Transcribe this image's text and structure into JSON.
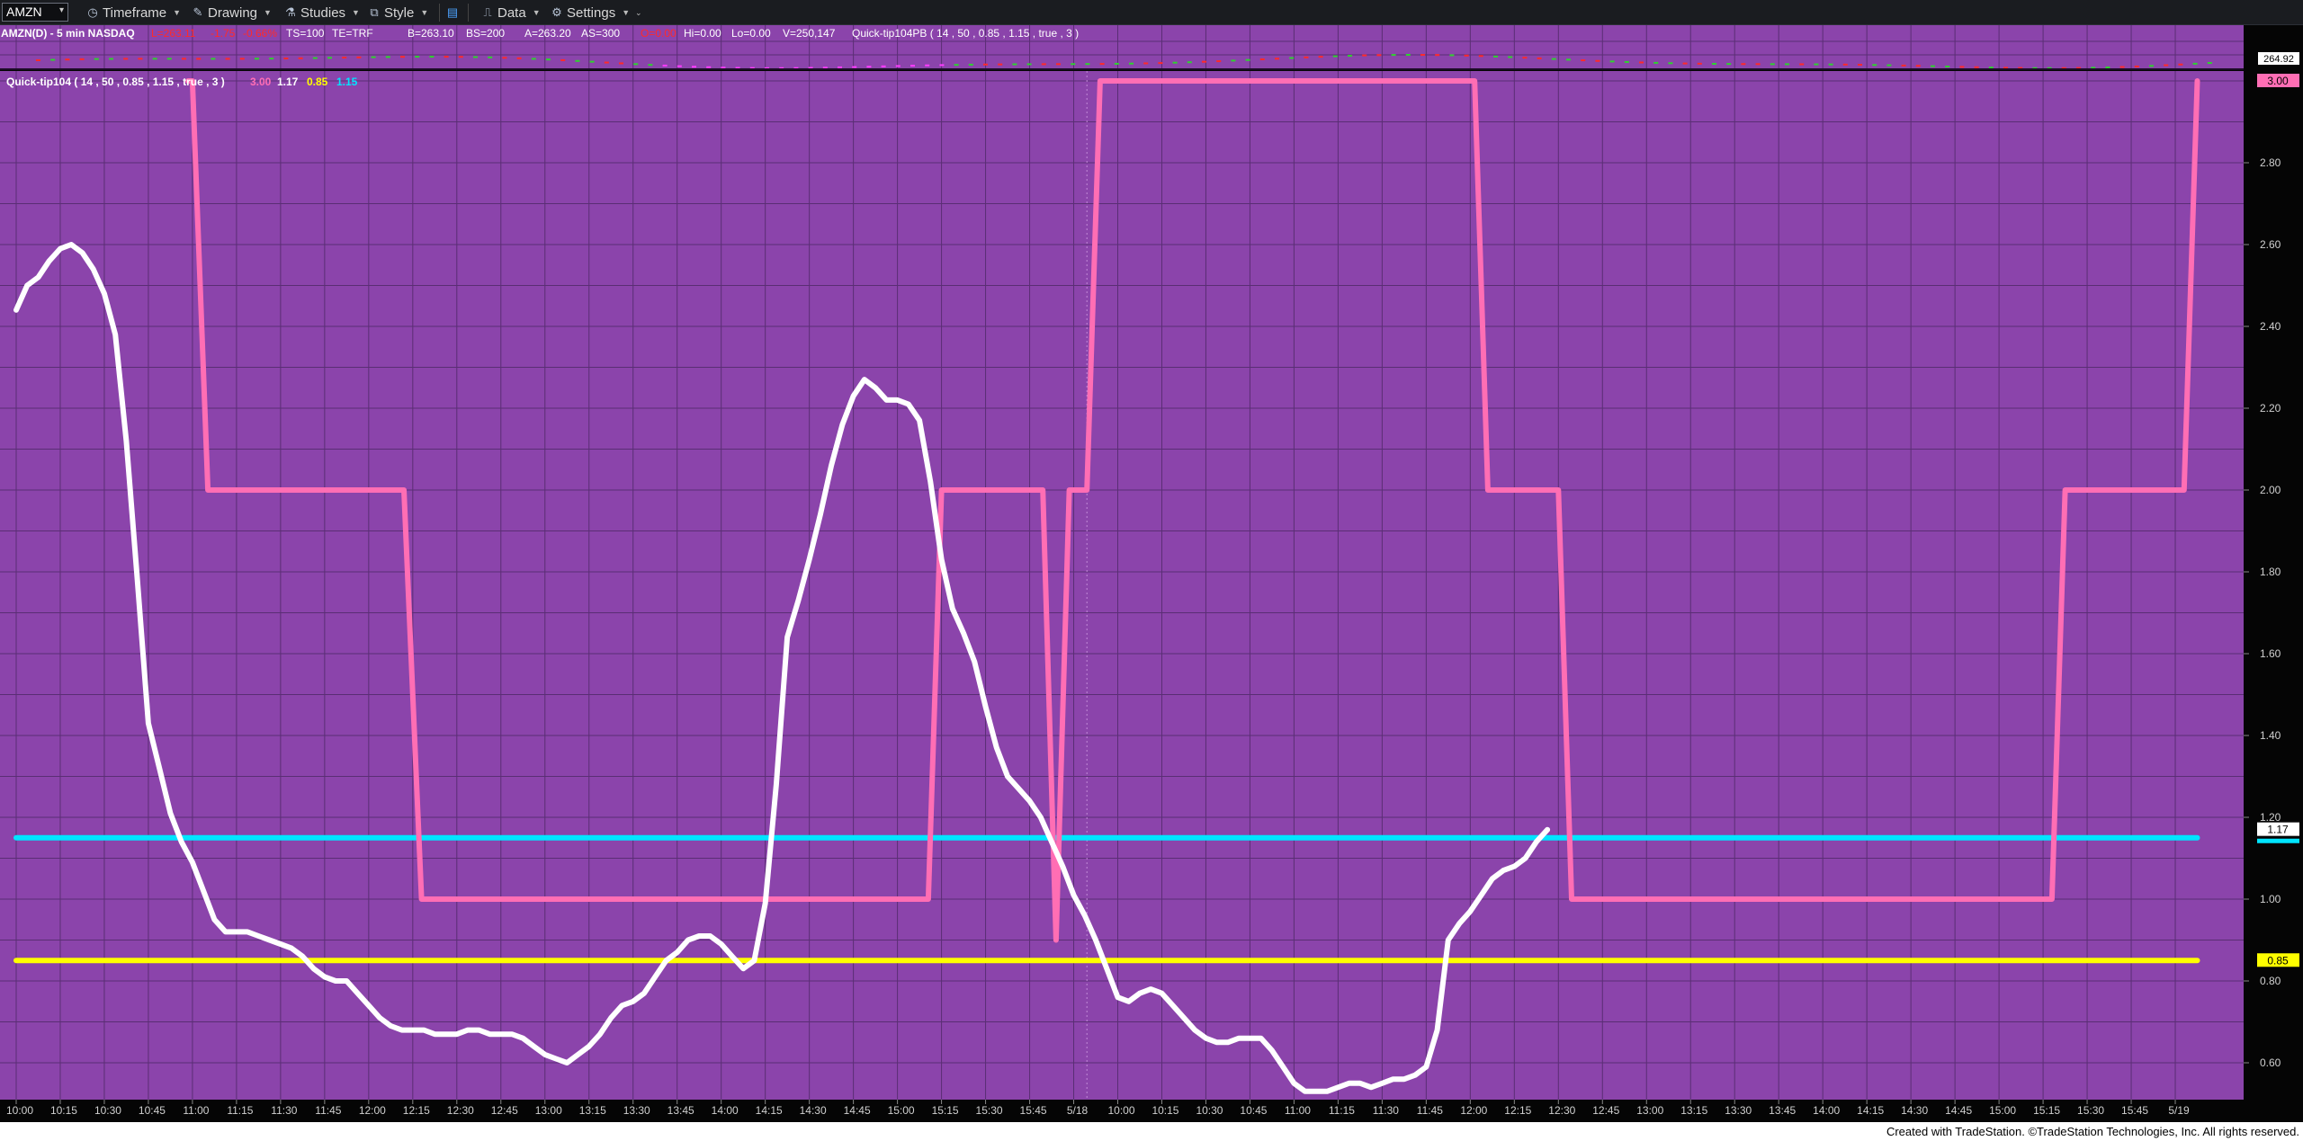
{
  "toolbar": {
    "symbol": "AMZN",
    "items": [
      "Timeframe",
      "Drawing",
      "Studies",
      "Style",
      "Data",
      "Settings"
    ],
    "icons": [
      "clock-icon",
      "pencil-icon",
      "flask-icon",
      "style-icon",
      "layout-icon",
      "data-icon",
      "gear-icon"
    ]
  },
  "status": {
    "symbol_info": "AMZN(D) - 5 min  NASDAQ",
    "last": "L=263.11",
    "change": "-1.75",
    "change_pct": "-0.66%",
    "ts": "TS=100",
    "te": "TE=TRF",
    "bid": "B=263.10",
    "bid_size": "BS=200",
    "ask": "A=263.20",
    "ask_size": "AS=300",
    "open": "O=0.00",
    "hi": "Hi=0.00",
    "lo": "Lo=0.00",
    "volume": "V=250,147",
    "study_pb": "Quick-tip104PB ( 14 , 50 , 0.85 , 1.15 , true , 3 )"
  },
  "price_scale_label": "264.92",
  "indicator_legend": {
    "name": "Quick-tip104 ( 14 , 50 , 0.85 , 1.15 , true , 3 )",
    "values": [
      "3.00",
      "1.17",
      "0.85",
      "1.15"
    ],
    "colors": [
      "#ff6eb4",
      "#ffffff",
      "#ffff00",
      "#00e5ff"
    ]
  },
  "footer": "Created with TradeStation. ©TradeStation Technologies, Inc. All rights reserved.",
  "colors": {
    "panel_bg": "#8b44ab",
    "grid": "#5a2e74",
    "state_line": "#ff6eb4",
    "osc_line": "#ffffff",
    "lower_threshold": "#ffff00",
    "upper_threshold": "#00e5ff",
    "up_tick": "#2fd12f",
    "down_tick": "#ff2a2a",
    "session_tick": "#ff3bff"
  },
  "chart_data": {
    "type": "line",
    "x": [
      "10:00",
      "10:15",
      "10:30",
      "10:45",
      "11:00",
      "11:15",
      "11:30",
      "11:45",
      "12:00",
      "12:15",
      "12:30",
      "12:45",
      "13:00",
      "13:15",
      "13:30",
      "13:45",
      "14:00",
      "14:15",
      "14:30",
      "14:45",
      "15:00",
      "15:15",
      "15:30",
      "15:45",
      "5/18",
      "10:00",
      "10:15",
      "10:30",
      "10:45",
      "11:00",
      "11:15",
      "11:30",
      "11:45",
      "12:00",
      "12:15",
      "12:30",
      "12:45",
      "13:00",
      "13:15",
      "13:30",
      "13:45",
      "14:00",
      "14:15",
      "14:30",
      "14:45",
      "15:00",
      "15:15",
      "15:30",
      "15:45",
      "5/19"
    ],
    "y_ticks": [
      "2.80",
      "2.60",
      "2.40",
      "2.20",
      "2.00",
      "1.80",
      "1.60",
      "1.40",
      "1.20",
      "1.00",
      "0.80",
      "0.60"
    ],
    "ylim": [
      0.52,
      3.02
    ],
    "series": [
      {
        "color": "#ff6eb4",
        "x_index": [
          3.9,
          4.0,
          4.35,
          8.8,
          9.2,
          20.7,
          21.0,
          23.3,
          23.6,
          23.9,
          24.3,
          24.6,
          24.9,
          33.1,
          33.4,
          35.0,
          35.3,
          46.2,
          46.5,
          49.2,
          49.5
        ],
        "values": [
          3.0,
          3.0,
          2.0,
          2.0,
          1.0,
          1.0,
          2.0,
          2.0,
          0.9,
          2.0,
          2.0,
          3.0,
          3.0,
          3.0,
          2.0,
          2.0,
          1.0,
          1.0,
          2.0,
          2.0,
          3.0
        ]
      },
      {
        "color": "#ffffff",
        "x_index": [
          0,
          0.25,
          0.5,
          0.75,
          1,
          1.25,
          1.5,
          1.75,
          2,
          2.25,
          2.5,
          2.75,
          3,
          3.25,
          3.5,
          3.75,
          4,
          4.25,
          4.5,
          4.75,
          5,
          5.25,
          5.5,
          5.75,
          6,
          6.25,
          6.5,
          6.75,
          7,
          7.25,
          7.5,
          7.75,
          8,
          8.25,
          8.5,
          8.75,
          9,
          9.25,
          9.5,
          9.75,
          10,
          10.25,
          10.5,
          10.75,
          11,
          11.25,
          11.5,
          11.75,
          12,
          12.25,
          12.5,
          12.75,
          13,
          13.25,
          13.5,
          13.75,
          14,
          14.25,
          14.5,
          14.75,
          15,
          15.25,
          15.5,
          15.75,
          16,
          16.25,
          16.5,
          16.75,
          17,
          17.25,
          17.5,
          17.75,
          18,
          18.25,
          18.5,
          18.75,
          19,
          19.25,
          19.5,
          19.75,
          20,
          20.25,
          20.5,
          20.75,
          21,
          21.25,
          21.5,
          21.75,
          22,
          22.25,
          22.5,
          22.75,
          23,
          23.25,
          23.5,
          23.75,
          24,
          24.25,
          24.5,
          24.75,
          25,
          25.25,
          25.5,
          25.75,
          26,
          26.25,
          26.5,
          26.75,
          27,
          27.25,
          27.5,
          27.75,
          28,
          28.25,
          28.5,
          28.75,
          29,
          29.25,
          29.5,
          29.75,
          30,
          30.25,
          30.5,
          30.75,
          31,
          31.25,
          31.5,
          31.75,
          32,
          32.25,
          32.5,
          32.75,
          33,
          33.25,
          33.5,
          33.75,
          34,
          34.25,
          34.5,
          34.75,
          35,
          35.25,
          35.5,
          35.75,
          36,
          36.25,
          36.5,
          36.75,
          37,
          37.25,
          37.5,
          37.75,
          38,
          38.25,
          38.5,
          38.75,
          39,
          39.25,
          39.5,
          39.75,
          40,
          40.25,
          40.5,
          40.75,
          41,
          41.25,
          41.5,
          41.75,
          42,
          42.25,
          42.5,
          42.75,
          43,
          43.25,
          43.5,
          43.75,
          44,
          44.25,
          44.5,
          44.75,
          45,
          45.25,
          45.5,
          45.75,
          46,
          46.25,
          46.5,
          46.75,
          47,
          47.25,
          47.5,
          47.75,
          48,
          48.25,
          48.5,
          48.75,
          49,
          49.25,
          49.5
        ],
        "values": [
          2.44,
          2.5,
          2.52,
          2.56,
          2.59,
          2.6,
          2.58,
          2.54,
          2.48,
          2.38,
          2.12,
          1.78,
          1.43,
          1.32,
          1.21,
          1.14,
          1.09,
          1.02,
          0.95,
          0.92,
          0.92,
          0.92,
          0.91,
          0.9,
          0.89,
          0.88,
          0.86,
          0.83,
          0.81,
          0.8,
          0.8,
          0.77,
          0.74,
          0.71,
          0.69,
          0.68,
          0.68,
          0.68,
          0.67,
          0.67,
          0.67,
          0.68,
          0.68,
          0.67,
          0.67,
          0.67,
          0.66,
          0.64,
          0.62,
          0.61,
          0.6,
          0.62,
          0.64,
          0.67,
          0.71,
          0.74,
          0.75,
          0.77,
          0.81,
          0.85,
          0.87,
          0.9,
          0.91,
          0.91,
          0.89,
          0.86,
          0.83,
          0.85,
          0.99,
          1.28,
          1.64,
          1.73,
          1.83,
          1.94,
          2.06,
          2.16,
          2.23,
          2.27,
          2.25,
          2.22,
          2.22,
          2.21,
          2.17,
          2.02,
          1.83,
          1.71,
          1.65,
          1.58,
          1.47,
          1.37,
          1.3,
          1.27,
          1.24,
          1.2,
          1.14,
          1.08,
          1.01,
          0.96,
          0.9,
          0.83,
          0.76,
          0.75,
          0.77,
          0.78,
          0.77,
          0.74,
          0.71,
          0.68,
          0.66,
          0.65,
          0.65,
          0.66,
          0.66,
          0.66,
          0.63,
          0.59,
          0.55,
          0.53,
          0.53,
          0.53,
          0.54,
          0.55,
          0.55,
          0.54,
          0.55,
          0.56,
          0.56,
          0.57,
          0.59,
          0.68,
          0.9,
          0.94,
          0.97,
          1.01,
          1.05,
          1.07,
          1.08,
          1.1,
          1.14,
          1.17
        ]
      },
      {
        "name": "0.85",
        "color": "#ffff00",
        "x_index": [
          0,
          49.5
        ],
        "values": [
          0.85,
          0.85
        ]
      },
      {
        "name": "1.15",
        "color": "#00e5ff",
        "x_index": [
          0,
          49.5
        ],
        "values": [
          1.15,
          1.15
        ]
      }
    ],
    "axis_markers": [
      {
        "value": "3.00",
        "color": "#ff6eb4"
      },
      {
        "value": "1.17",
        "color": "#ffffff"
      },
      {
        "value": "0.85",
        "color": "#ffff00"
      }
    ],
    "grid": true,
    "legend": "top-left"
  }
}
